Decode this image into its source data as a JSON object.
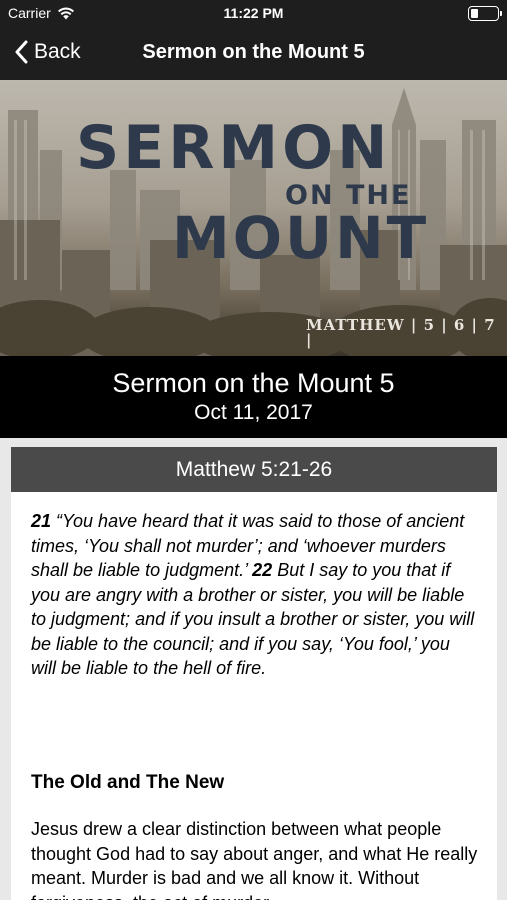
{
  "status_bar": {
    "carrier": "Carrier",
    "time": "11:22 PM",
    "battery_level": 0.3
  },
  "nav": {
    "back_label": "Back",
    "title": "Sermon on the Mount 5"
  },
  "hero": {
    "line1": "SERMON",
    "line2": "ON THE",
    "line3": "MOUNT",
    "reference": "MATTHEW | 5 | 6 | 7 |"
  },
  "sermon": {
    "title": "Sermon on the Mount 5",
    "date": "Oct 11, 2017"
  },
  "passage": {
    "reference": "Matthew 5:21-26",
    "verse21_num": "21",
    "verse21_text": " “You have heard that it was said to those of ancient times, ‘You shall not murder’; and ‘whoever murders shall be liable to judgment.’ ",
    "verse22_num": "22",
    "verse22_text": " But I say to you that if you are angry with a brother or sister, you will be liable to judgment; and if you insult a brother or sister, you will be liable to the council; and if you say, ‘You fool,’ you will be liable to the hell of fire."
  },
  "notes": {
    "heading": "The Old and The New",
    "body": "Jesus drew a clear distinction between what people thought God had to say about anger, and what He really meant. Murder is bad and we all know it. Without forgiveness, the act of murder"
  },
  "colors": {
    "nav_bg": "#1e1e1e",
    "title_bg": "#000000",
    "card_header_bg": "#4a4a4a",
    "hero_text": "#2e3a4c"
  }
}
